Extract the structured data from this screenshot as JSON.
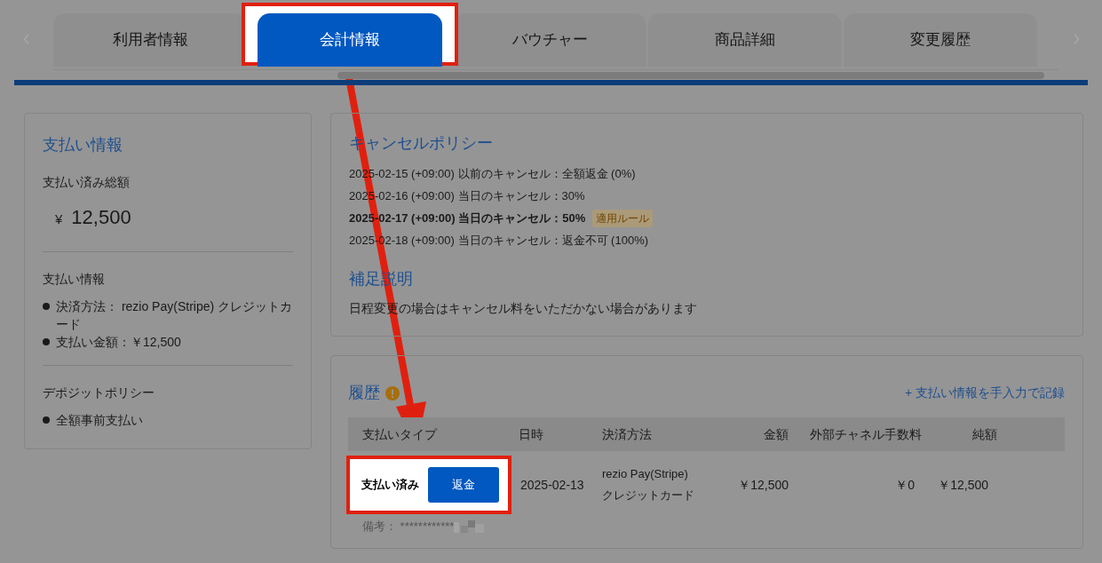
{
  "tabs": [
    {
      "label": "利用者情報",
      "selected": false
    },
    {
      "label": "会計情報",
      "selected": true
    },
    {
      "label": "バウチャー",
      "selected": false
    },
    {
      "label": "商品詳細",
      "selected": false
    },
    {
      "label": "変更履歴",
      "selected": false
    }
  ],
  "payment_card": {
    "title": "支払い情報",
    "total_label": "支払い済み総額",
    "currency": "¥",
    "total": "12,500",
    "sections": [
      {
        "title": "支払い情報",
        "items": [
          "決済方法： rezio Pay(Stripe) クレジットカード",
          "支払い金額：￥12,500"
        ]
      },
      {
        "title": "デポジットポリシー",
        "items": [
          "全額事前支払い"
        ]
      }
    ]
  },
  "cancel_policy": {
    "title": "キャンセルポリシー",
    "rules": [
      {
        "text": "2025-02-15 (+09:00) 以前のキャンセル：全額返金 (0%)",
        "applied": false
      },
      {
        "text": "2025-02-16 (+09:00) 当日のキャンセル：30%",
        "applied": false
      },
      {
        "text": "2025-02-17 (+09:00) 当日のキャンセル：50%",
        "applied": true,
        "badge": "適用ルール"
      },
      {
        "text": "2025-02-18 (+09:00) 当日のキャンセル：返金不可 (100%)",
        "applied": false
      }
    ],
    "note_title": "補足説明",
    "note": "日程変更の場合はキャンセル料をいただかない場合があります"
  },
  "history": {
    "title": "履歴",
    "add_link": "+ 支払い情報を手入力で記録",
    "columns": [
      "支払いタイプ",
      "日時",
      "決済方法",
      "金額",
      "外部チャネル手数料",
      "純額"
    ],
    "rows": [
      {
        "type": "支払い済み",
        "action": "返金",
        "date": "2025-02-13",
        "method": [
          "rezio Pay(Stripe)",
          "クレジットカード"
        ],
        "amount": "￥12,500",
        "fee": "￥0",
        "net": "￥12,500",
        "memo": "備考： ************",
        "highlighted": true
      }
    ]
  }
}
